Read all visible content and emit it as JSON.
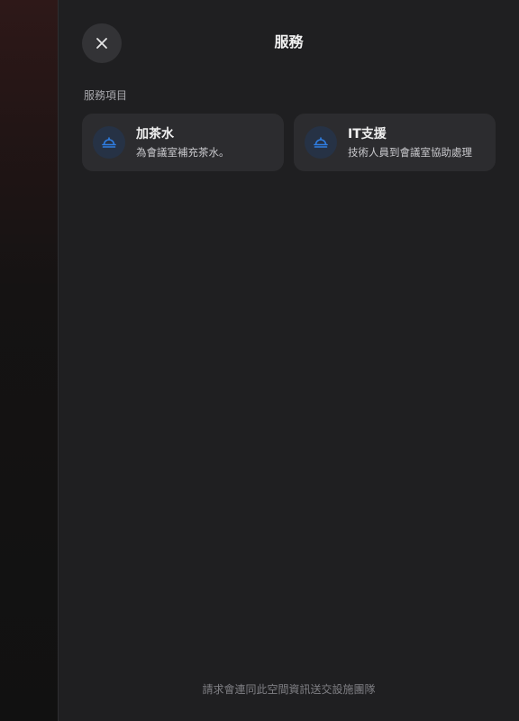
{
  "header": {
    "title": "服務",
    "close_icon": "close-icon"
  },
  "section": {
    "label": "服務項目"
  },
  "services": [
    {
      "title": "加茶水",
      "description": "為會議室補充茶水。",
      "icon": "service-bell-icon"
    },
    {
      "title": "IT支援",
      "description": "技術人員到會議室協助處理",
      "icon": "service-bell-icon"
    }
  ],
  "footer": {
    "note": "請求會連同此空間資訊送交設施團隊"
  },
  "colors": {
    "accent": "#2f7de1",
    "panel_bg": "#1f1f21",
    "card_bg": "#2c2c2f"
  }
}
